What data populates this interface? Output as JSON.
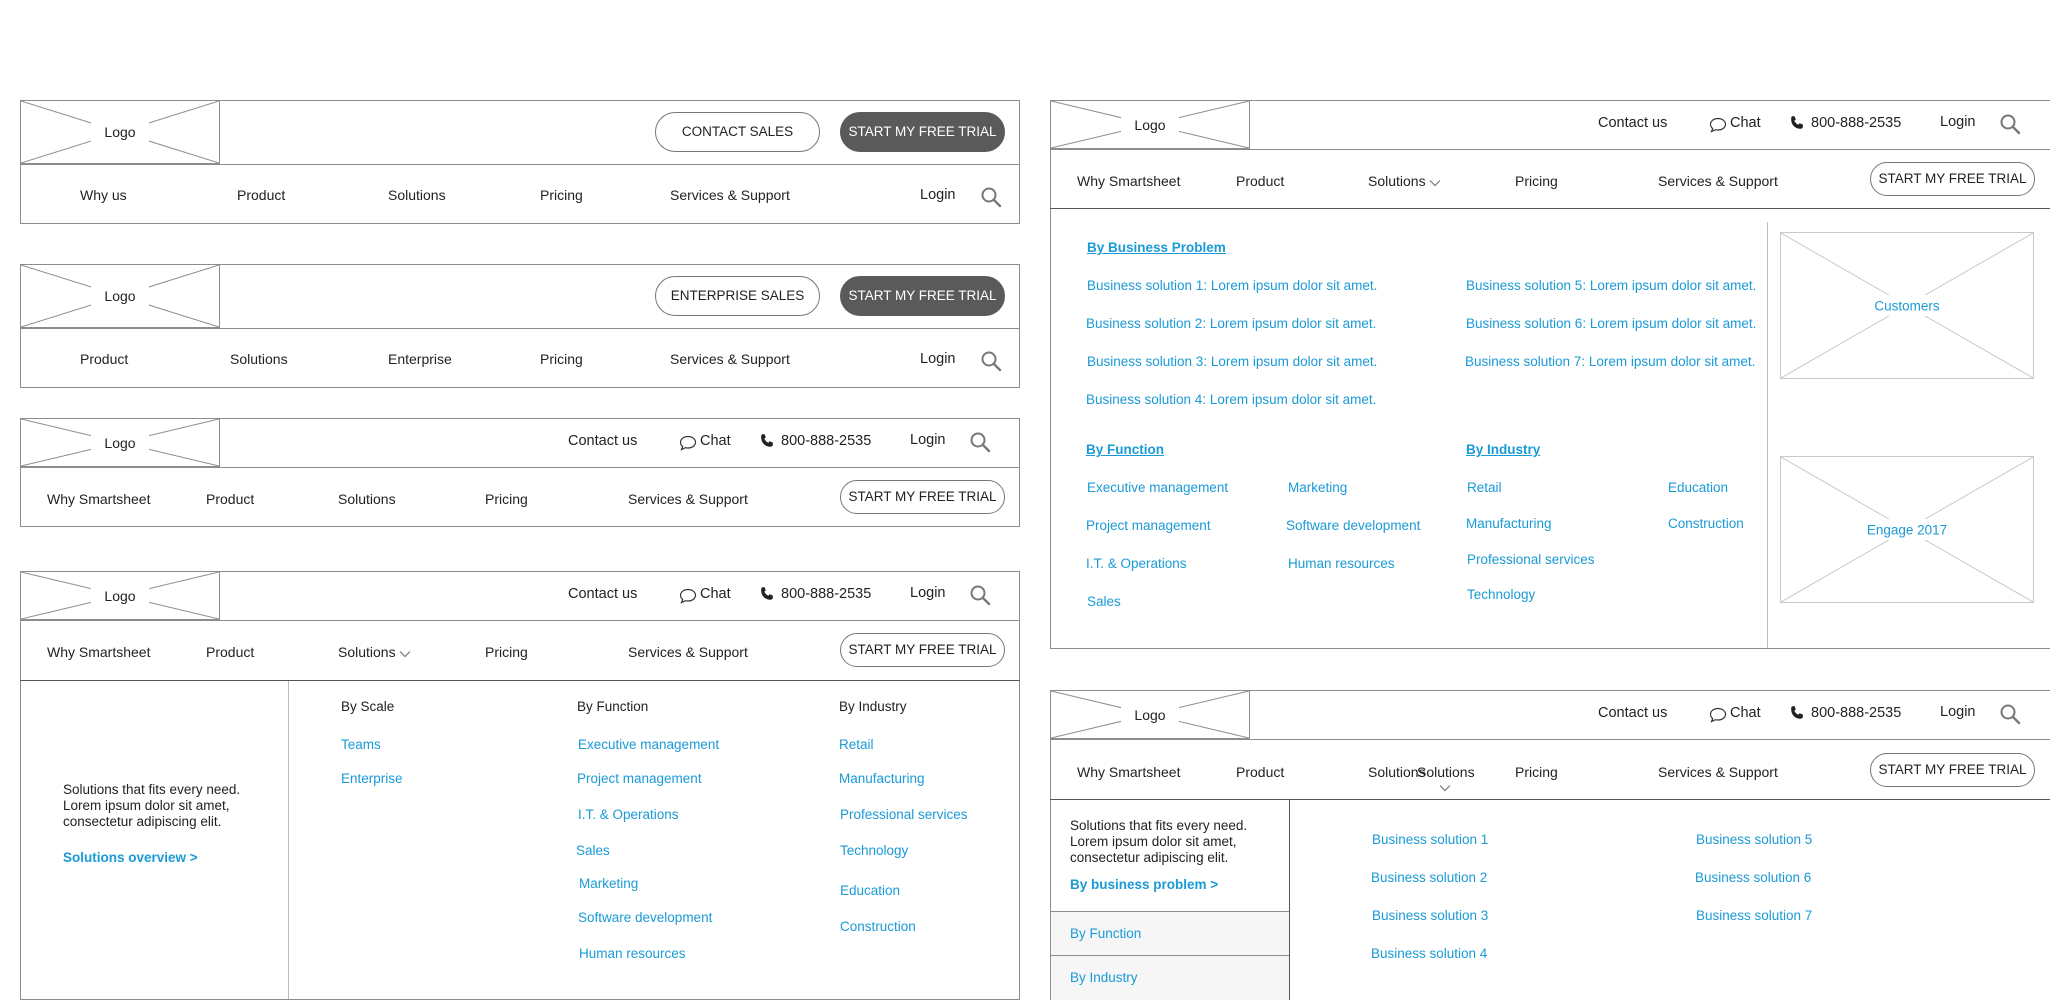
{
  "common": {
    "logo": "Logo",
    "login": "Login",
    "contact_us": "Contact us",
    "chat": "Chat",
    "phone": "800-888-2535",
    "free_trial": "START MY FREE TRIAL"
  },
  "nav1": {
    "contact_sales": "CONTACT SALES",
    "items": [
      "Why us",
      "Product",
      "Solutions",
      "Pricing",
      "Services & Support"
    ]
  },
  "nav2": {
    "enterprise_sales": "ENTERPRISE SALES",
    "items": [
      "Product",
      "Solutions",
      "Enterprise",
      "Pricing",
      "Services & Support"
    ]
  },
  "nav3": {
    "items": [
      "Why Smartsheet",
      "Product",
      "Solutions",
      "Pricing",
      "Services & Support"
    ]
  },
  "nav4": {
    "items": [
      "Why Smartsheet",
      "Product",
      "Solutions",
      "Pricing",
      "Services & Support"
    ],
    "intro": "Solutions that fits every need. Lorem ipsum dolor sit amet, consectetur adipiscing elit.",
    "overview_link": "Solutions overview >",
    "by_scale": {
      "title": "By Scale",
      "items": [
        "Teams",
        "Enterprise"
      ]
    },
    "by_function": {
      "title": "By Function",
      "items": [
        "Executive management",
        "Project management",
        "I.T. & Operations",
        "Sales",
        "Marketing",
        "Software development",
        "Human resources"
      ]
    },
    "by_industry": {
      "title": "By Industry",
      "items": [
        "Retail",
        "Manufacturing",
        "Professional services",
        "Technology",
        "Education",
        "Construction"
      ]
    }
  },
  "nav5": {
    "items": [
      "Why Smartsheet",
      "Product",
      "Solutions",
      "Pricing",
      "Services & Support"
    ],
    "by_business_problem": {
      "title": "By Business Problem",
      "col1": [
        "Business solution 1: Lorem ipsum dolor sit amet.",
        "Business solution 2: Lorem ipsum dolor sit amet.",
        "Business solution 3: Lorem ipsum dolor sit amet.",
        "Business solution 4: Lorem ipsum dolor sit amet."
      ],
      "col2": [
        "Business solution 5: Lorem ipsum dolor sit amet.",
        "Business solution 6: Lorem ipsum dolor sit amet.",
        "Business solution 7: Lorem ipsum dolor sit amet."
      ]
    },
    "by_function": {
      "title": "By Function",
      "col1": [
        "Executive management",
        "Project management",
        "I.T. & Operations",
        "Sales"
      ],
      "col2": [
        "Marketing",
        "Software development",
        "Human resources"
      ]
    },
    "by_industry": {
      "title": "By Industry",
      "col1": [
        "Retail",
        "Manufacturing",
        "Professional services",
        "Technology"
      ],
      "col2": [
        "Education",
        "Construction"
      ]
    },
    "promo1": "Customers",
    "promo2": "Engage 2017"
  },
  "nav6": {
    "items": [
      "Why Smartsheet",
      "Product",
      "Solutions",
      "Pricing",
      "Services & Support"
    ],
    "solutions_overlap": "Solutions",
    "intro": "Solutions that fits every need. Lorem ipsum dolor sit amet, consectetur adipiscing elit.",
    "business_problem_link": "By business problem >",
    "tab_function": "By Function",
    "tab_industry": "By Industry",
    "col1": [
      "Business solution 1",
      "Business solution 2",
      "Business solution 3",
      "Business solution 4"
    ],
    "col2": [
      "Business solution 5",
      "Business solution 6",
      "Business solution 7"
    ]
  }
}
